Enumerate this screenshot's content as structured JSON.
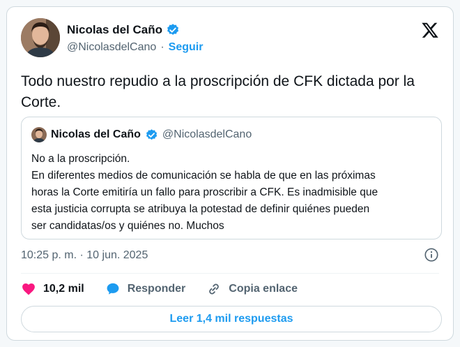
{
  "author": {
    "name": "Nicolas del Caño",
    "handle": "@NicolasdelCano",
    "separator": "·",
    "follow_label": "Seguir",
    "verified_icon": "verified-badge-icon"
  },
  "tweet": {
    "text": "Todo nuestro repudio a la proscripción de CFK dictada por la Corte."
  },
  "quote": {
    "name": "Nicolas del Caño",
    "handle": "@NicolasdelCano",
    "lines": [
      "No a la proscripción.",
      "En diferentes medios de comunicación se habla de que en las próximas",
      "horas la Corte emitiría un fallo para proscribir a CFK. Es inadmisible que",
      "esta justicia corrupta se atribuya la potestad de definir quiénes pueden",
      "ser candidatas/os y quiénes no. Muchos"
    ]
  },
  "timestamp": "10:25 p. m. · 10 jun. 2025",
  "actions": {
    "likes": "10,2 mil",
    "reply_label": "Responder",
    "copy_label": "Copia enlace"
  },
  "read_replies_label": "Leer 1,4 mil respuestas",
  "colors": {
    "accent": "#1d9bf0",
    "like": "#f91880",
    "text": "#0f1419",
    "muted": "#536471",
    "border": "#cfd9de"
  }
}
